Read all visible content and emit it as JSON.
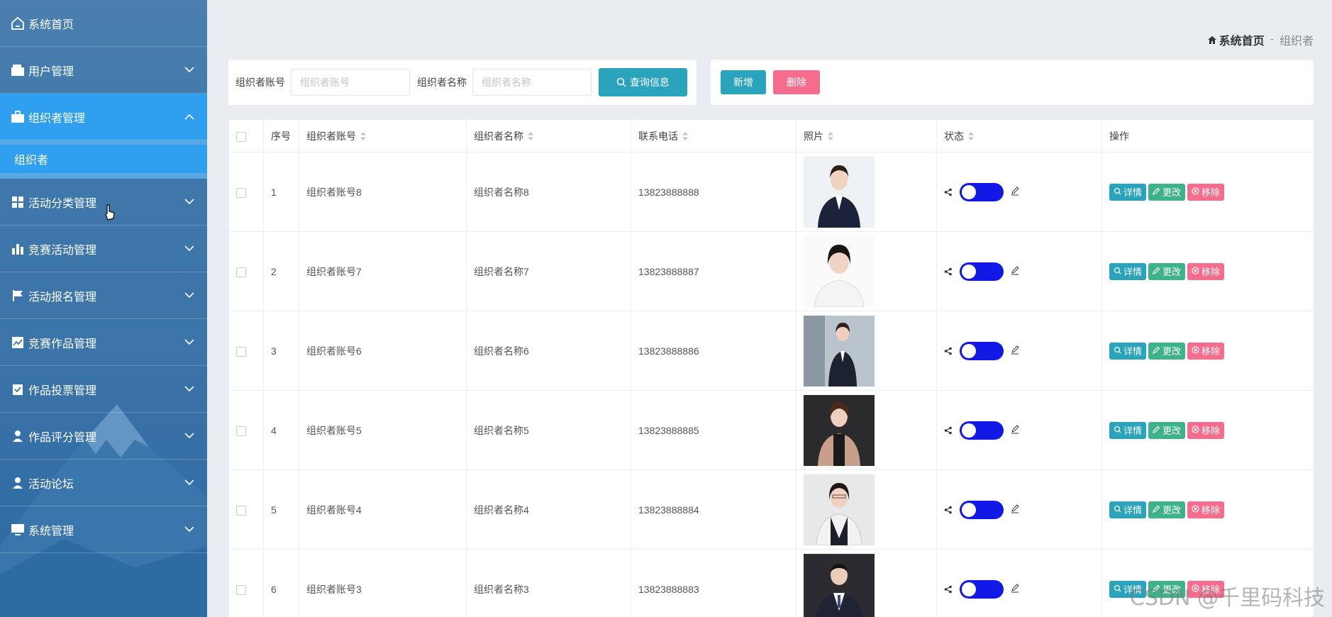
{
  "sidebar": {
    "items": [
      {
        "label": "系统首页",
        "icon": "home-icon"
      },
      {
        "label": "用户管理",
        "icon": "wallet-icon"
      },
      {
        "label": "组织者管理",
        "icon": "briefcase-icon"
      },
      {
        "label": "活动分类管理",
        "icon": "grid-icon"
      },
      {
        "label": "竞赛活动管理",
        "icon": "bar-chart-icon"
      },
      {
        "label": "活动报名管理",
        "icon": "flag-icon"
      },
      {
        "label": "竞赛作品管理",
        "icon": "line-chart-icon"
      },
      {
        "label": "作品投票管理",
        "icon": "clipboard-check-icon"
      },
      {
        "label": "作品评分管理",
        "icon": "user-icon"
      },
      {
        "label": "活动论坛",
        "icon": "user-icon"
      },
      {
        "label": "系统管理",
        "icon": "monitor-icon"
      }
    ],
    "sub_item": "组织者"
  },
  "breadcrumb": {
    "home": "系统首页",
    "separator": "-",
    "current": "组织者"
  },
  "search": {
    "account_label": "组织者账号",
    "account_placeholder": "组织者账号",
    "name_label": "组织者名称",
    "name_placeholder": "组织者名称",
    "button": "查询信息"
  },
  "actions": {
    "add": "新增",
    "delete": "删除"
  },
  "table": {
    "headers": [
      "序号",
      "组织者账号",
      "组织者名称",
      "联系电话",
      "照片",
      "状态",
      "操作"
    ],
    "op_labels": {
      "detail": "详情",
      "edit": "更改",
      "remove": "移除"
    },
    "rows": [
      {
        "index": "1",
        "account": "组织者账号8",
        "name": "组织者名称8",
        "phone": "13823888888"
      },
      {
        "index": "2",
        "account": "组织者账号7",
        "name": "组织者名称7",
        "phone": "13823888887"
      },
      {
        "index": "3",
        "account": "组织者账号6",
        "name": "组织者名称6",
        "phone": "13823888886"
      },
      {
        "index": "4",
        "account": "组织者账号5",
        "name": "组织者名称5",
        "phone": "13823888885"
      },
      {
        "index": "5",
        "account": "组织者账号4",
        "name": "组织者名称4",
        "phone": "13823888884"
      },
      {
        "index": "6",
        "account": "组织者账号3",
        "name": "组织者名称3",
        "phone": "13823888883"
      }
    ]
  },
  "watermark": "CSDN @千里码科技",
  "colors": {
    "accent": "#2aa3bd",
    "danger": "#f56c8d",
    "edit": "#3cb38a",
    "toggle": "#1218e6",
    "sidebar_active": "#2f9fef"
  }
}
